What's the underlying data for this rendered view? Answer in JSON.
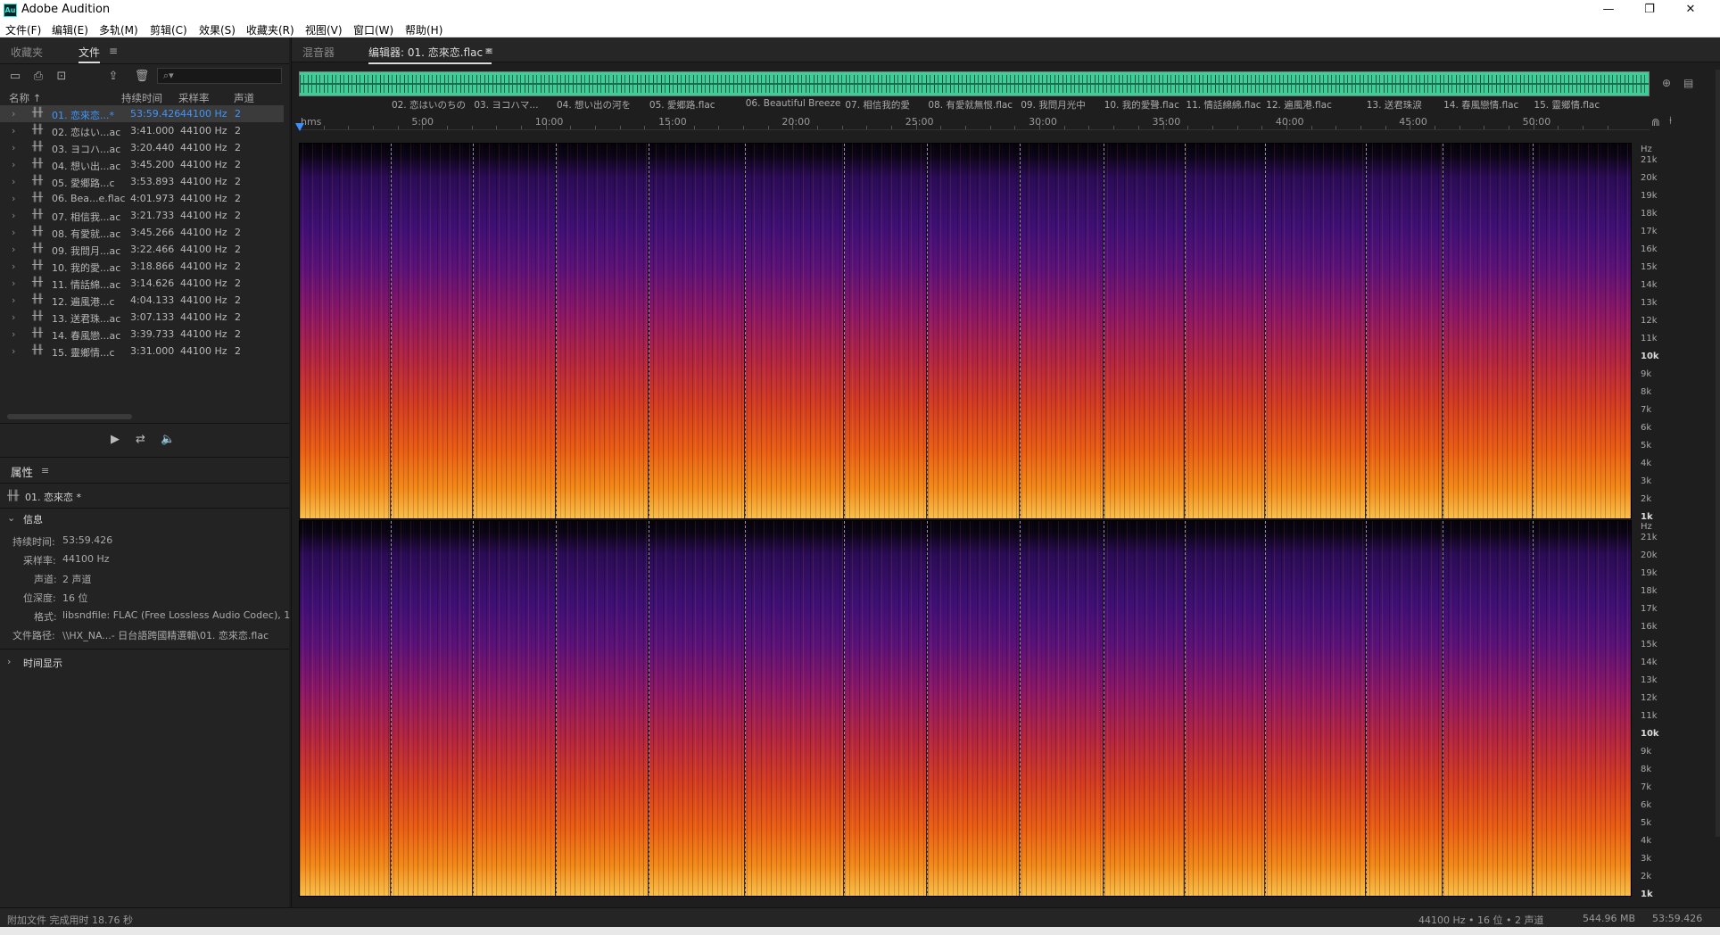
{
  "window": {
    "title": "Adobe Audition",
    "app_icon_text": "Au",
    "controls": [
      "—",
      "❐",
      "✕"
    ]
  },
  "menu": [
    "文件(F)",
    "编辑(E)",
    "多轨(M)",
    "剪辑(C)",
    "效果(S)",
    "收藏夹(R)",
    "视图(V)",
    "窗口(W)",
    "帮助(H)"
  ],
  "left_tabs": {
    "favorites": "收藏夹",
    "files": "文件",
    "menu_icon": "≡"
  },
  "file_columns": {
    "name": "名称 ↑",
    "duration": "持续时间",
    "rate": "采样率",
    "channels": "声道"
  },
  "files": [
    {
      "name": "01. 恋來恋...*",
      "dur": "53:59.426",
      "rate": "44100 Hz",
      "ch": "2",
      "selected": true
    },
    {
      "name": "02. 恋はい...ac",
      "dur": "3:41.000",
      "rate": "44100 Hz",
      "ch": "2"
    },
    {
      "name": "03. ヨコハ...ac",
      "dur": "3:20.440",
      "rate": "44100 Hz",
      "ch": "2"
    },
    {
      "name": "04. 想い出...ac",
      "dur": "3:45.200",
      "rate": "44100 Hz",
      "ch": "2"
    },
    {
      "name": "05. 愛郷路...c",
      "dur": "3:53.893",
      "rate": "44100 Hz",
      "ch": "2"
    },
    {
      "name": "06. Bea...e.flac",
      "dur": "4:01.973",
      "rate": "44100 Hz",
      "ch": "2"
    },
    {
      "name": "07. 相信我...ac",
      "dur": "3:21.733",
      "rate": "44100 Hz",
      "ch": "2"
    },
    {
      "name": "08. 有愛就...ac",
      "dur": "3:45.266",
      "rate": "44100 Hz",
      "ch": "2"
    },
    {
      "name": "09. 我問月...ac",
      "dur": "3:22.466",
      "rate": "44100 Hz",
      "ch": "2"
    },
    {
      "name": "10. 我的愛...ac",
      "dur": "3:18.866",
      "rate": "44100 Hz",
      "ch": "2"
    },
    {
      "name": "11. 情話綿...ac",
      "dur": "3:14.626",
      "rate": "44100 Hz",
      "ch": "2"
    },
    {
      "name": "12. 遍風港...c",
      "dur": "4:04.133",
      "rate": "44100 Hz",
      "ch": "2"
    },
    {
      "name": "13. 送君珠...ac",
      "dur": "3:07.133",
      "rate": "44100 Hz",
      "ch": "2"
    },
    {
      "name": "14. 春風戀...ac",
      "dur": "3:39.733",
      "rate": "44100 Hz",
      "ch": "2"
    },
    {
      "name": "15. 靈鄉情...c",
      "dur": "3:31.000",
      "rate": "44100 Hz",
      "ch": "2"
    }
  ],
  "properties": {
    "title": "属性",
    "file": "01. 恋來恋 *",
    "info_header": "信息",
    "rows": [
      {
        "label": "持续时间:",
        "value": "53:59.426"
      },
      {
        "label": "采样率:",
        "value": "44100 Hz"
      },
      {
        "label": "声道:",
        "value": "2 声道"
      },
      {
        "label": "位深度:",
        "value": "16 位"
      },
      {
        "label": "格式:",
        "value": "libsndfile: FLAC (Free Lossless Audio Codec), 1..."
      },
      {
        "label": "文件路径:",
        "value": "\\\\HX_NA...- 日台語跨國精選輯\\01. 恋來恋.flac"
      }
    ],
    "time_display": "时间显示"
  },
  "editor_tabs": {
    "mixer": "混音器",
    "editor": "编辑器: 01. 恋來恋.flac *"
  },
  "markers": [
    {
      "label": "02. 恋はいのちの",
      "t": 3.684
    },
    {
      "label": "03. ヨコハマ...",
      "t": 7.024
    },
    {
      "label": "04. 想い出の河を",
      "t": 10.37
    },
    {
      "label": "05. 愛郷路.flac",
      "t": 14.126
    },
    {
      "label": "06. Beautiful Breeze",
      "t": 18.024
    },
    {
      "label": "07. 相信我的愛",
      "t": 22.056
    },
    {
      "label": "08. 有愛就無恨.flac",
      "t": 25.418
    },
    {
      "label": "09. 我問月光中",
      "t": 29.172
    },
    {
      "label": "10. 我的愛聲.flac",
      "t": 32.549
    },
    {
      "label": "11. 情話綿綿.flac",
      "t": 35.863
    },
    {
      "label": "12. 遍風港.flac",
      "t": 39.107
    },
    {
      "label": "13. 送君珠淚",
      "t": 43.176
    },
    {
      "label": "14. 春風戀情.flac",
      "t": 46.296
    },
    {
      "label": "15. 靈鄉情.flac",
      "t": 49.958
    }
  ],
  "timeline": {
    "unit": "hms",
    "total_min": 53.99,
    "ticks": [
      "5:00",
      "10:00",
      "15:00",
      "20:00",
      "25:00",
      "30:00",
      "35:00",
      "40:00",
      "45:00",
      "50:00"
    ]
  },
  "hz_axis": [
    "Hz",
    "21k",
    "20k",
    "19k",
    "18k",
    "17k",
    "16k",
    "15k",
    "14k",
    "13k",
    "12k",
    "11k",
    "10k",
    "9k",
    "8k",
    "7k",
    "6k",
    "5k",
    "4k",
    "3k",
    "2k",
    "1k"
  ],
  "status": {
    "left": "附加文件 完成用时 18.76 秒",
    "format": "44100 Hz • 16 位 • 2 声道",
    "size": "544.96 MB",
    "duration": "53:59.426"
  }
}
